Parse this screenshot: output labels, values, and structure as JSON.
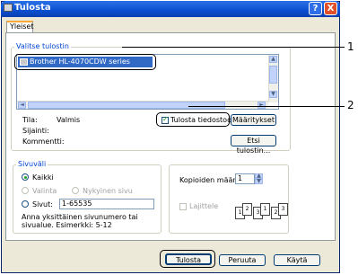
{
  "window": {
    "title": "Tulosta",
    "help": "?",
    "close": "X"
  },
  "tabs": [
    {
      "label": "Yleiset"
    }
  ],
  "printer_group": {
    "legend": "Valitse tulostin",
    "printers": [
      {
        "name": "Brother HL-4070CDW series"
      }
    ],
    "status_label": "Tila:",
    "status_value": "Valmis",
    "location_label": "Sijainti:",
    "comment_label": "Kommentti:",
    "print_to_file_label": "Tulosta tiedostoon",
    "print_to_file_checked": true,
    "preferences_button": "Määritykset",
    "find_printer_button": "Etsi tulostin..."
  },
  "page_range": {
    "legend": "Sivuväli",
    "all": "Kaikki",
    "selection": "Valinta",
    "current_page": "Nykyinen sivu",
    "pages": "Sivut:",
    "pages_value": "1-65535",
    "hint": "Anna yksittäinen sivunumero tai sivualue. Esimerkki: 5-12",
    "selected": "all"
  },
  "copies": {
    "label": "Kopioiden määrä:",
    "value": "1",
    "collate_label": "Lajittele",
    "collate_checked": false,
    "pages": [
      "1",
      "2",
      "3"
    ]
  },
  "buttons": {
    "print": "Tulosta",
    "cancel": "Peruuta",
    "apply": "Käytä"
  },
  "callouts": [
    "1",
    "2"
  ]
}
